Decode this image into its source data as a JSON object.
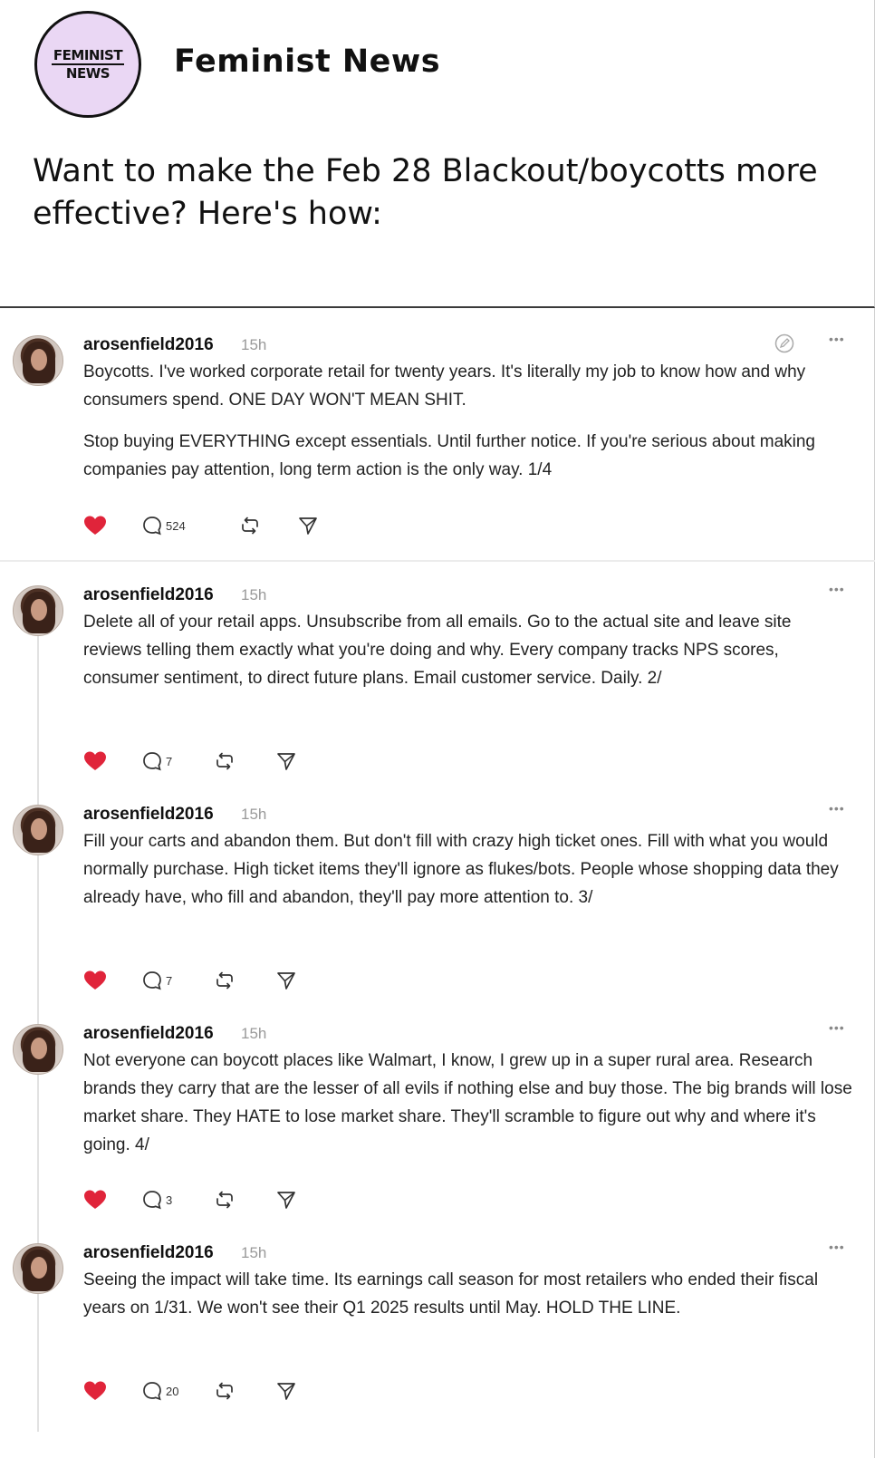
{
  "header": {
    "logo_line1": "FEMINIST",
    "logo_line2": "NEWS",
    "brand_name": "Feminist News",
    "headline": "Want to make the Feb 28 Blackout/boycotts more effective? Here's how:"
  },
  "colors": {
    "logo_bg": "#ead7f4",
    "heart": "#e0243a",
    "timestamp": "#9a9a9a"
  },
  "posts": [
    {
      "username": "arosenfield2016",
      "time": "15h",
      "paragraphs": [
        "Boycotts. I've worked corporate retail for twenty years. It's literally my job to know how and why consumers spend. ONE DAY WON'T MEAN SHIT.",
        "Stop buying EVERYTHING except essentials. Until further notice. If you're serious about making companies pay attention, long term action is the only way. 1/4"
      ],
      "replies": "524",
      "liked": true,
      "icons": [
        "heart-icon",
        "reply-icon",
        "repost-icon",
        "share-icon",
        "edit-icon",
        "more-icon"
      ]
    },
    {
      "username": "arosenfield2016",
      "time": "15h",
      "paragraphs": [
        "Delete all of your retail apps. Unsubscribe from all emails. Go to the actual site and leave site reviews telling them exactly what you're doing and why. Every company tracks NPS scores, consumer sentiment, to direct future plans. Email customer service. Daily. 2/"
      ],
      "replies": "7",
      "liked": true
    },
    {
      "username": "arosenfield2016",
      "time": "15h",
      "paragraphs": [
        "Fill your carts and abandon them. But don't fill with crazy high ticket ones. Fill with what you would normally purchase. High ticket items they'll ignore as flukes/bots. People whose shopping data they already have, who fill and abandon, they'll pay more attention to. 3/"
      ],
      "replies": "7",
      "liked": true
    },
    {
      "username": "arosenfield2016",
      "time": "15h",
      "paragraphs": [
        "Not everyone can boycott places like Walmart, I know, I grew up in a super rural area. Research brands they carry that are the lesser of all evils if nothing else and buy those. The big brands will lose market share. They HATE to lose market share. They'll scramble to figure out why and where it's going. 4/"
      ],
      "replies": "3",
      "liked": true
    },
    {
      "username": "arosenfield2016",
      "time": "15h",
      "paragraphs": [
        "Seeing the impact will take time. Its earnings call season for most retailers who ended their fiscal years on 1/31. We won't see their Q1 2025 results until May. HOLD THE LINE."
      ],
      "replies": "20",
      "liked": true
    }
  ]
}
